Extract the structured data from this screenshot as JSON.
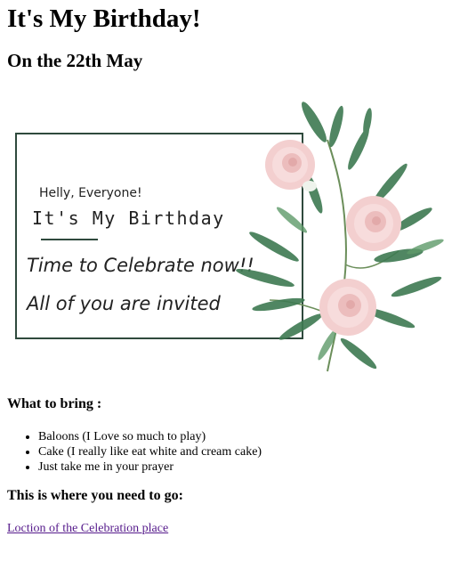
{
  "page": {
    "title": "It's My Birthday!",
    "subtitle": "On the 22th May"
  },
  "card": {
    "greeting": "Helly, Everyone!",
    "headline": "It's My Birthday",
    "tagline": "Time to Celebrate now!!",
    "invite": "All of you are invited",
    "colors": {
      "frame": "#2f4a3d",
      "leaf": "#3e7a52",
      "rose": "#f3cfcf"
    }
  },
  "bring": {
    "heading": "What to bring :",
    "items": [
      "Baloons (I Love so much to play)",
      "Cake (I really like eat white and cream cake)",
      "Just take me in your prayer"
    ]
  },
  "directions": {
    "heading": "This is where you need to go:",
    "link_text": "Loction of the Celebration place",
    "link_color": "#551a8b"
  }
}
